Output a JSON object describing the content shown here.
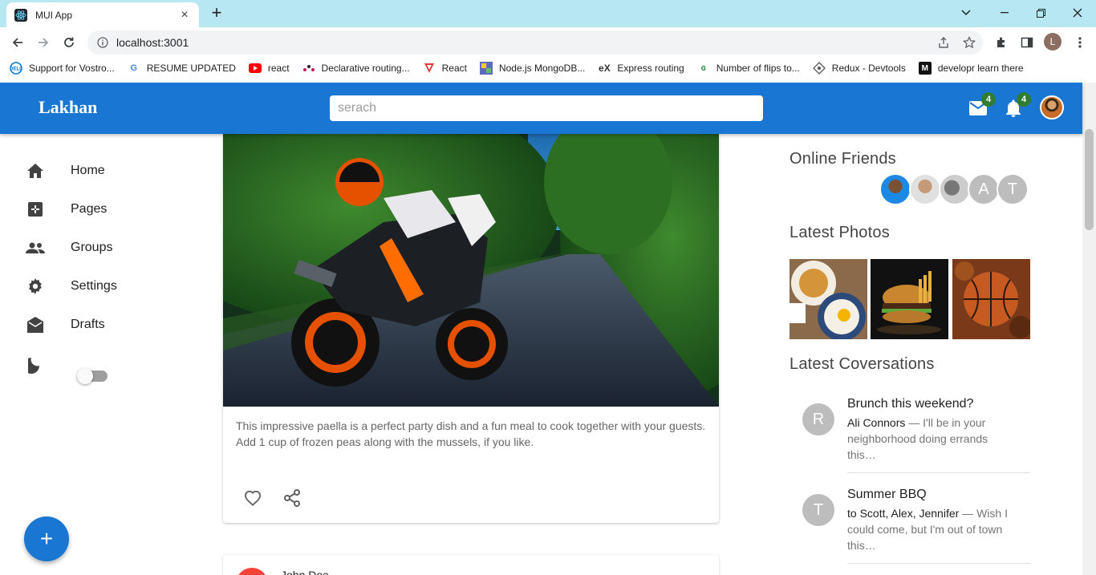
{
  "browser": {
    "tab_title": "MUI App",
    "url": "localhost:3001",
    "profile_initial": "L",
    "bookmarks": [
      {
        "label": "Support for Vostro...",
        "icon": "dell-icon"
      },
      {
        "label": "RESUME UPDATED",
        "icon": "google-icon"
      },
      {
        "label": "react",
        "icon": "youtube-icon"
      },
      {
        "label": "Declarative routing...",
        "icon": "react-router-icon"
      },
      {
        "label": "React",
        "icon": "react-v-icon"
      },
      {
        "label": "Node.js MongoDB...",
        "icon": "image-icon"
      },
      {
        "label": "Express routing",
        "icon": "express-icon"
      },
      {
        "label": "Number of flips to...",
        "icon": "gfg-icon"
      },
      {
        "label": "Redux - Devtools",
        "icon": "redux-icon"
      },
      {
        "label": "developr learn there",
        "icon": "m-icon"
      }
    ]
  },
  "appbar": {
    "brand": "Lakhan",
    "search_placeholder": "serach",
    "mail_badge": "4",
    "notif_badge": "4"
  },
  "sidebar": {
    "items": [
      {
        "label": "Home",
        "icon": "home-icon"
      },
      {
        "label": "Pages",
        "icon": "pages-icon"
      },
      {
        "label": "Groups",
        "icon": "groups-icon"
      },
      {
        "label": "Settings",
        "icon": "settings-icon"
      },
      {
        "label": "Drafts",
        "icon": "drafts-icon"
      }
    ],
    "dark_mode_on": false
  },
  "feed": {
    "post_text": "This impressive paella is a perfect party dish and a fun meal to cook together with your guests. Add 1 cup of frozen peas along with the mussels, if you like.",
    "next_post_author": "John Doe"
  },
  "rightbar": {
    "online_title": "Online Friends",
    "friends": [
      "",
      "",
      "",
      "A",
      "T"
    ],
    "photos_title": "Latest Photos",
    "conversations_title": "Latest Coversations",
    "conversations": [
      {
        "avatar": "R",
        "title": "Brunch this weekend?",
        "who": "Ali Connors",
        "text": " — I'll be in your neighborhood doing errands this…"
      },
      {
        "avatar": "T",
        "title": "Summer BBQ",
        "who": "to Scott, Alex, Jennifer",
        "text": " — Wish I could come, but I'm out of town this…"
      }
    ]
  },
  "colors": {
    "primary": "#1976d2",
    "badge": "#2e7d32",
    "tabstrip": "#b7e7f1"
  }
}
